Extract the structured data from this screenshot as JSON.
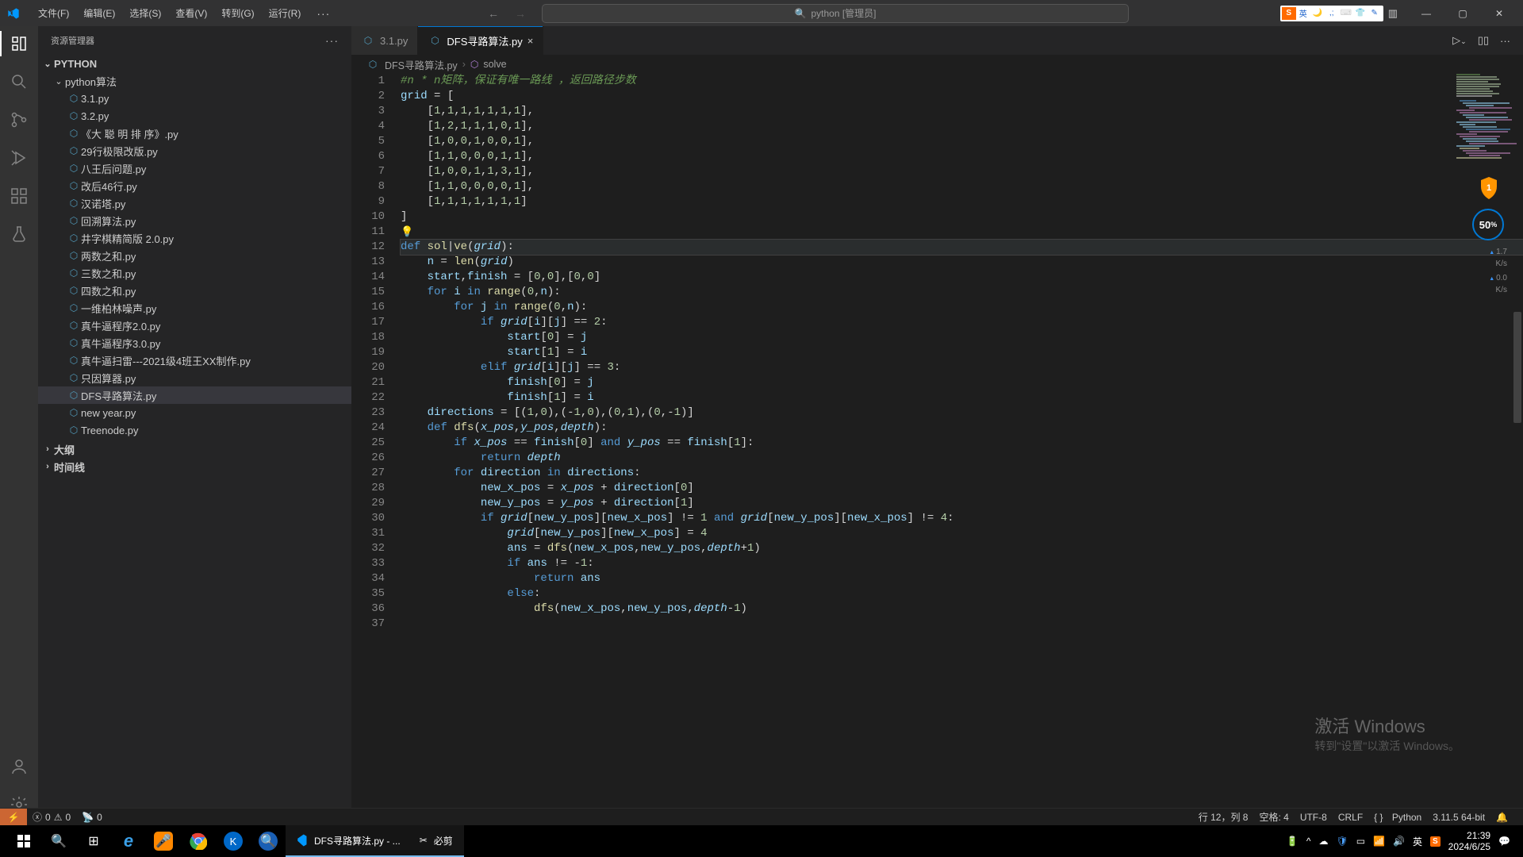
{
  "title_bar": {
    "menu": [
      "文件(F)",
      "编辑(E)",
      "选择(S)",
      "查看(V)",
      "转到(G)",
      "运行(R)"
    ],
    "search_text": "python [管理员]"
  },
  "sidebar": {
    "title": "资源管理器",
    "root": "PYTHON",
    "folder": "python算法",
    "files": [
      "3.1.py",
      "3.2.py",
      "《大 聪 明 排 序》.py",
      "29行极限改版.py",
      "八王后问题.py",
      "改后46行.py",
      "汉诺塔.py",
      "回溯算法.py",
      "井字棋精简版 2.0.py",
      "两数之和.py",
      "三数之和.py",
      "四数之和.py",
      "一维柏林噪声.py",
      "真牛逼程序2.0.py",
      "真牛逼程序3.0.py",
      "真牛逼扫雷---2021级4班王XX制作.py",
      "只因算器.py",
      "DFS寻路算法.py",
      "new year.py",
      "Treenode.py"
    ],
    "outline": "大纲",
    "timeline": "时间线"
  },
  "tabs": {
    "inactive": "3.1.py",
    "active": "DFS寻路算法.py"
  },
  "breadcrumb": {
    "file": "DFS寻路算法.py",
    "symbol": "solve"
  },
  "speed": {
    "pct": "50",
    "unit": "%",
    "up": "1.7",
    "down": "0.0",
    "ks": "K/s"
  },
  "statusbar": {
    "errors": "0",
    "warnings": "0",
    "ports": "0",
    "ln_col": "行 12，列 8",
    "spaces": "空格: 4",
    "enc": "UTF-8",
    "eol": "CRLF",
    "lang_icon": "{ }",
    "lang": "Python",
    "ver": "3.11.5 64-bit"
  },
  "watermark": {
    "l1": "激活 Windows",
    "l2": "转到\"设置\"以激活 Windows。"
  },
  "taskbar": {
    "vscode_title": "DFS寻路算法.py - ...",
    "bijian": "必剪",
    "time": "21:39",
    "date": "2024/6/25",
    "ime": "英"
  },
  "code_lines": [
    {
      "n": 1,
      "html": "<span class='c-com'>#n * n矩阵，保证有唯一路线 ，返回路径步数</span>"
    },
    {
      "n": 2,
      "html": "<span class='c-var'>grid</span> <span class='c-op'>=</span> ["
    },
    {
      "n": 3,
      "html": "    [<span class='c-num'>1</span>,<span class='c-num'>1</span>,<span class='c-num'>1</span>,<span class='c-num'>1</span>,<span class='c-num'>1</span>,<span class='c-num'>1</span>,<span class='c-num'>1</span>],"
    },
    {
      "n": 4,
      "html": "    [<span class='c-num'>1</span>,<span class='c-num'>2</span>,<span class='c-num'>1</span>,<span class='c-num'>1</span>,<span class='c-num'>1</span>,<span class='c-num'>0</span>,<span class='c-num'>1</span>],"
    },
    {
      "n": 5,
      "html": "    [<span class='c-num'>1</span>,<span class='c-num'>0</span>,<span class='c-num'>0</span>,<span class='c-num'>1</span>,<span class='c-num'>0</span>,<span class='c-num'>0</span>,<span class='c-num'>1</span>],"
    },
    {
      "n": 6,
      "html": "    [<span class='c-num'>1</span>,<span class='c-num'>1</span>,<span class='c-num'>0</span>,<span class='c-num'>0</span>,<span class='c-num'>0</span>,<span class='c-num'>1</span>,<span class='c-num'>1</span>],"
    },
    {
      "n": 7,
      "html": "    [<span class='c-num'>1</span>,<span class='c-num'>0</span>,<span class='c-num'>0</span>,<span class='c-num'>1</span>,<span class='c-num'>1</span>,<span class='c-num'>3</span>,<span class='c-num'>1</span>],"
    },
    {
      "n": 8,
      "html": "    [<span class='c-num'>1</span>,<span class='c-num'>1</span>,<span class='c-num'>0</span>,<span class='c-num'>0</span>,<span class='c-num'>0</span>,<span class='c-num'>0</span>,<span class='c-num'>1</span>],"
    },
    {
      "n": 9,
      "html": "    [<span class='c-num'>1</span>,<span class='c-num'>1</span>,<span class='c-num'>1</span>,<span class='c-num'>1</span>,<span class='c-num'>1</span>,<span class='c-num'>1</span>,<span class='c-num'>1</span>]"
    },
    {
      "n": 10,
      "html": "]"
    },
    {
      "n": 11,
      "html": "<span class='lightbulb'>💡</span>"
    },
    {
      "n": 12,
      "hl": true,
      "html": "<span class='c-kw'>def</span> <span class='c-fn'>sol</span>|<span class='c-fn'>ve</span>(<span class='c-par'>grid</span>):"
    },
    {
      "n": 13,
      "html": "    <span class='c-var'>n</span> <span class='c-op'>=</span> <span class='c-fn'>len</span>(<span class='c-var-i'>grid</span>)"
    },
    {
      "n": 14,
      "html": "    <span class='c-var'>start</span>,<span class='c-var'>finish</span> <span class='c-op'>=</span> [<span class='c-num'>0</span>,<span class='c-num'>0</span>],[<span class='c-num'>0</span>,<span class='c-num'>0</span>]"
    },
    {
      "n": 15,
      "html": "    <span class='c-kw'>for</span> <span class='c-var'>i</span> <span class='c-kw'>in</span> <span class='c-fn'>range</span>(<span class='c-num'>0</span>,<span class='c-var'>n</span>):"
    },
    {
      "n": 16,
      "html": "        <span class='c-kw'>for</span> <span class='c-var'>j</span> <span class='c-kw'>in</span> <span class='c-fn'>range</span>(<span class='c-num'>0</span>,<span class='c-var'>n</span>):"
    },
    {
      "n": 17,
      "html": "            <span class='c-kw'>if</span> <span class='c-var-i'>grid</span>[<span class='c-var'>i</span>][<span class='c-var'>j</span>] <span class='c-op'>==</span> <span class='c-num'>2</span>:"
    },
    {
      "n": 18,
      "html": "                <span class='c-var'>start</span>[<span class='c-num'>0</span>] <span class='c-op'>=</span> <span class='c-var'>j</span>"
    },
    {
      "n": 19,
      "html": "                <span class='c-var'>start</span>[<span class='c-num'>1</span>] <span class='c-op'>=</span> <span class='c-var'>i</span>"
    },
    {
      "n": 20,
      "html": "            <span class='c-kw'>elif</span> <span class='c-var-i'>grid</span>[<span class='c-var'>i</span>][<span class='c-var'>j</span>] <span class='c-op'>==</span> <span class='c-num'>3</span>:"
    },
    {
      "n": 21,
      "html": "                <span class='c-var'>finish</span>[<span class='c-num'>0</span>] <span class='c-op'>=</span> <span class='c-var'>j</span>"
    },
    {
      "n": 22,
      "html": "                <span class='c-var'>finish</span>[<span class='c-num'>1</span>] <span class='c-op'>=</span> <span class='c-var'>i</span>"
    },
    {
      "n": 23,
      "html": "    <span class='c-var'>directions</span> <span class='c-op'>=</span> [(<span class='c-num'>1</span>,<span class='c-num'>0</span>),(<span class='c-op'>-</span><span class='c-num'>1</span>,<span class='c-num'>0</span>),(<span class='c-num'>0</span>,<span class='c-num'>1</span>),(<span class='c-num'>0</span>,<span class='c-op'>-</span><span class='c-num'>1</span>)]"
    },
    {
      "n": 24,
      "html": "    <span class='c-kw'>def</span> <span class='c-fn'>dfs</span>(<span class='c-par'>x_pos</span>,<span class='c-par'>y_pos</span>,<span class='c-par'>depth</span>):"
    },
    {
      "n": 25,
      "html": "        <span class='c-kw'>if</span> <span class='c-var-i'>x_pos</span> <span class='c-op'>==</span> <span class='c-var'>finish</span>[<span class='c-num'>0</span>] <span class='c-kw'>and</span> <span class='c-var-i'>y_pos</span> <span class='c-op'>==</span> <span class='c-var'>finish</span>[<span class='c-num'>1</span>]:"
    },
    {
      "n": 26,
      "html": "            <span class='c-kw'>return</span> <span class='c-var-i'>depth</span>"
    },
    {
      "n": 27,
      "html": "        <span class='c-kw'>for</span> <span class='c-var'>direction</span> <span class='c-kw'>in</span> <span class='c-var'>directions</span>:"
    },
    {
      "n": 28,
      "html": "            <span class='c-var'>new_x_pos</span> <span class='c-op'>=</span> <span class='c-var-i'>x_pos</span> <span class='c-op'>+</span> <span class='c-var'>direction</span>[<span class='c-num'>0</span>]"
    },
    {
      "n": 29,
      "html": "            <span class='c-var'>new_y_pos</span> <span class='c-op'>=</span> <span class='c-var-i'>y_pos</span> <span class='c-op'>+</span> <span class='c-var'>direction</span>[<span class='c-num'>1</span>]"
    },
    {
      "n": 30,
      "html": "            <span class='c-kw'>if</span> <span class='c-var-i'>grid</span>[<span class='c-var'>new_y_pos</span>][<span class='c-var'>new_x_pos</span>] <span class='c-op'>!=</span> <span class='c-num'>1</span> <span class='c-kw'>and</span> <span class='c-var-i'>grid</span>[<span class='c-var'>new_y_pos</span>][<span class='c-var'>new_x_pos</span>] <span class='c-op'>!=</span> <span class='c-num'>4</span>:"
    },
    {
      "n": 31,
      "html": "                <span class='c-var-i'>grid</span>[<span class='c-var'>new_y_pos</span>][<span class='c-var'>new_x_pos</span>] <span class='c-op'>=</span> <span class='c-num'>4</span>"
    },
    {
      "n": 32,
      "html": "                <span class='c-var'>ans</span> <span class='c-op'>=</span> <span class='c-fn'>dfs</span>(<span class='c-var'>new_x_pos</span>,<span class='c-var'>new_y_pos</span>,<span class='c-var-i'>depth</span><span class='c-op'>+</span><span class='c-num'>1</span>)"
    },
    {
      "n": 33,
      "html": "                <span class='c-kw'>if</span> <span class='c-var'>ans</span> <span class='c-op'>!=</span> <span class='c-op'>-</span><span class='c-num'>1</span>:"
    },
    {
      "n": 34,
      "html": "                    <span class='c-kw'>return</span> <span class='c-var'>ans</span>"
    },
    {
      "n": 35,
      "html": "                <span class='c-kw'>else</span>:"
    },
    {
      "n": 36,
      "html": "                    <span class='c-fn'>dfs</span>(<span class='c-var'>new_x_pos</span>,<span class='c-var'>new_y_pos</span>,<span class='c-var-i'>depth</span><span class='c-op'>-</span><span class='c-num'>1</span>)"
    },
    {
      "n": 37,
      "html": ""
    }
  ]
}
